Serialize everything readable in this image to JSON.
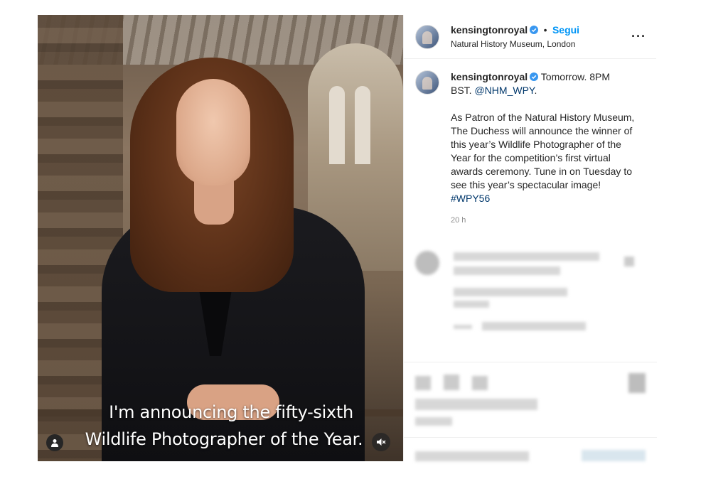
{
  "post": {
    "video": {
      "caption_line1": "I'm announcing the fifty-sixth",
      "caption_line2": "Wildlife Photographer of the Year."
    },
    "header": {
      "username": "kensingtonroyal",
      "dot": "•",
      "follow_label": "Segui",
      "location": "Natural History Museum, London",
      "more_label": "···"
    },
    "caption": {
      "username": "kensingtonroyal",
      "line1_part": "Tomorrow. 8PM",
      "line2_prefix": "BST. ",
      "mention": "@NHM_WPY",
      "line2_suffix": ".",
      "body": "As Patron of the Natural History Museum, The Duchess will announce the winner of this year’s Wildlife Photographer of the Year for the competition’s first virtual awards ceremony. Tune in on Tuesday to see this year’s spectacular image! ",
      "hashtag": "#WPY56",
      "timestamp": "20 h"
    },
    "colors": {
      "link_blue": "#0095f6",
      "tag_blue": "#00376b",
      "verified_blue": "#3897f0"
    }
  }
}
